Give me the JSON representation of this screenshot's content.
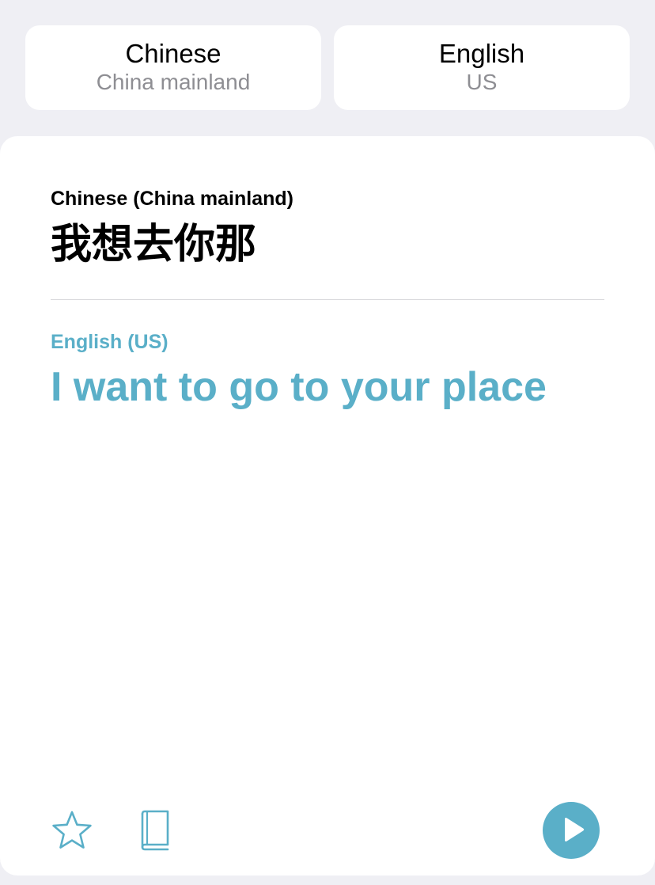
{
  "language_picker": {
    "source": {
      "name": "Chinese",
      "region": "China mainland"
    },
    "target": {
      "name": "English",
      "region": "US"
    }
  },
  "translation": {
    "source_label": "Chinese (China mainland)",
    "source_text": "我想去你那",
    "target_label": "English (US)",
    "target_text": "I want to go to your place"
  },
  "toolbar": {
    "favorite_icon": "star-icon",
    "dictionary_icon": "book-icon",
    "play_icon": "play-icon"
  },
  "colors": {
    "accent": "#5aafc8",
    "background": "#efeff4",
    "card": "#ffffff",
    "secondary_text": "#8e8e93"
  }
}
